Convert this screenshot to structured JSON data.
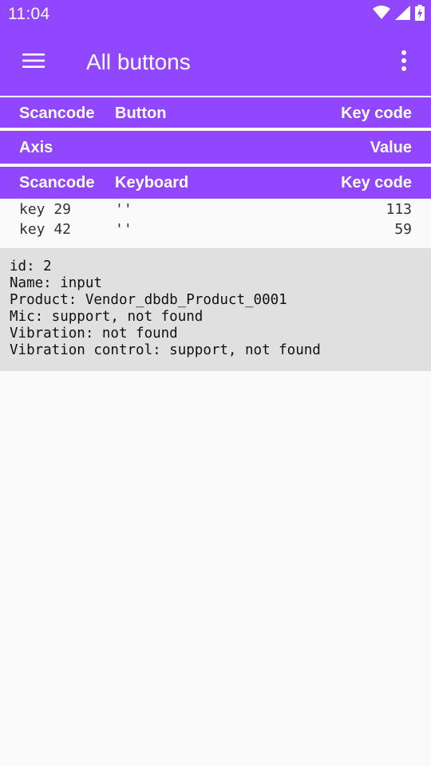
{
  "status_bar": {
    "time": "11:04",
    "icons": [
      "wifi-icon",
      "signal-icon",
      "battery-charging-icon"
    ]
  },
  "app_bar": {
    "title": "All buttons",
    "menu_icon": "hamburger-menu-icon",
    "overflow_icon": "more-vert-icon"
  },
  "colors": {
    "accent": "#9146ff",
    "background": "#fafafa",
    "info_panel": "#e0e0e0"
  },
  "button_header": {
    "scancode": "Scancode",
    "button": "Button",
    "key_code": "Key code"
  },
  "axis_header": {
    "axis": "Axis",
    "value": "Value"
  },
  "keyboard_header": {
    "scancode": "Scancode",
    "keyboard": "Keyboard",
    "key_code": "Key code"
  },
  "keyboard_rows": [
    {
      "scancode": "key 29",
      "keyboard": "''",
      "key_code": "113"
    },
    {
      "scancode": "key 42",
      "keyboard": "''",
      "key_code": "59"
    }
  ],
  "device_info": {
    "lines": [
      "id: 2",
      "Name: input",
      "Product: Vendor_dbdb_Product_0001",
      "Mic: support, not found",
      "Vibration: not found",
      "Vibration control: support, not found"
    ]
  }
}
